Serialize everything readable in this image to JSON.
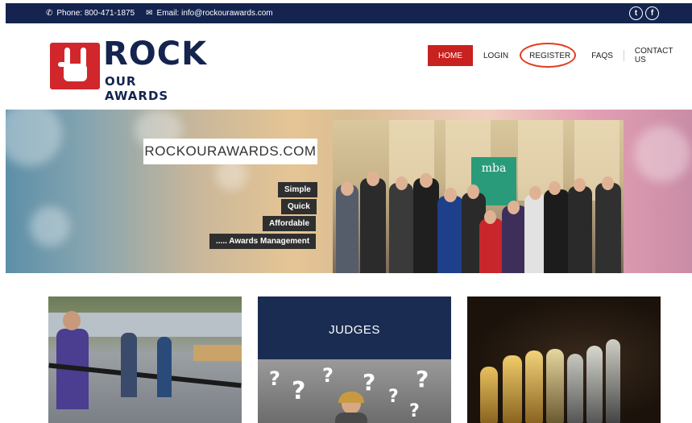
{
  "topbar": {
    "phone": "Phone: 800-471-1875",
    "email": "Email: info@rockourawards.com",
    "social": [
      "twitter-icon",
      "facebook-icon"
    ]
  },
  "logo": {
    "word1": "ROCK",
    "word2": "OUR AWARDS"
  },
  "nav": {
    "items": [
      {
        "label": "HOME",
        "active": true
      },
      {
        "label": "LOGIN"
      },
      {
        "label": "REGISTER",
        "highlighted": true
      },
      {
        "label": "FAQS"
      },
      {
        "label": "CONTACT US"
      }
    ]
  },
  "hero": {
    "title": "ROCKOURAWARDS.COM",
    "tags": [
      "Simple",
      "Quick",
      "Affordable",
      "..... Awards Management"
    ],
    "banner_text": "mba"
  },
  "tiles": {
    "judges_title": "JUDGES"
  },
  "colors": {
    "navy": "#14244f",
    "red": "#c8211f",
    "ring": "#e33b1f"
  }
}
